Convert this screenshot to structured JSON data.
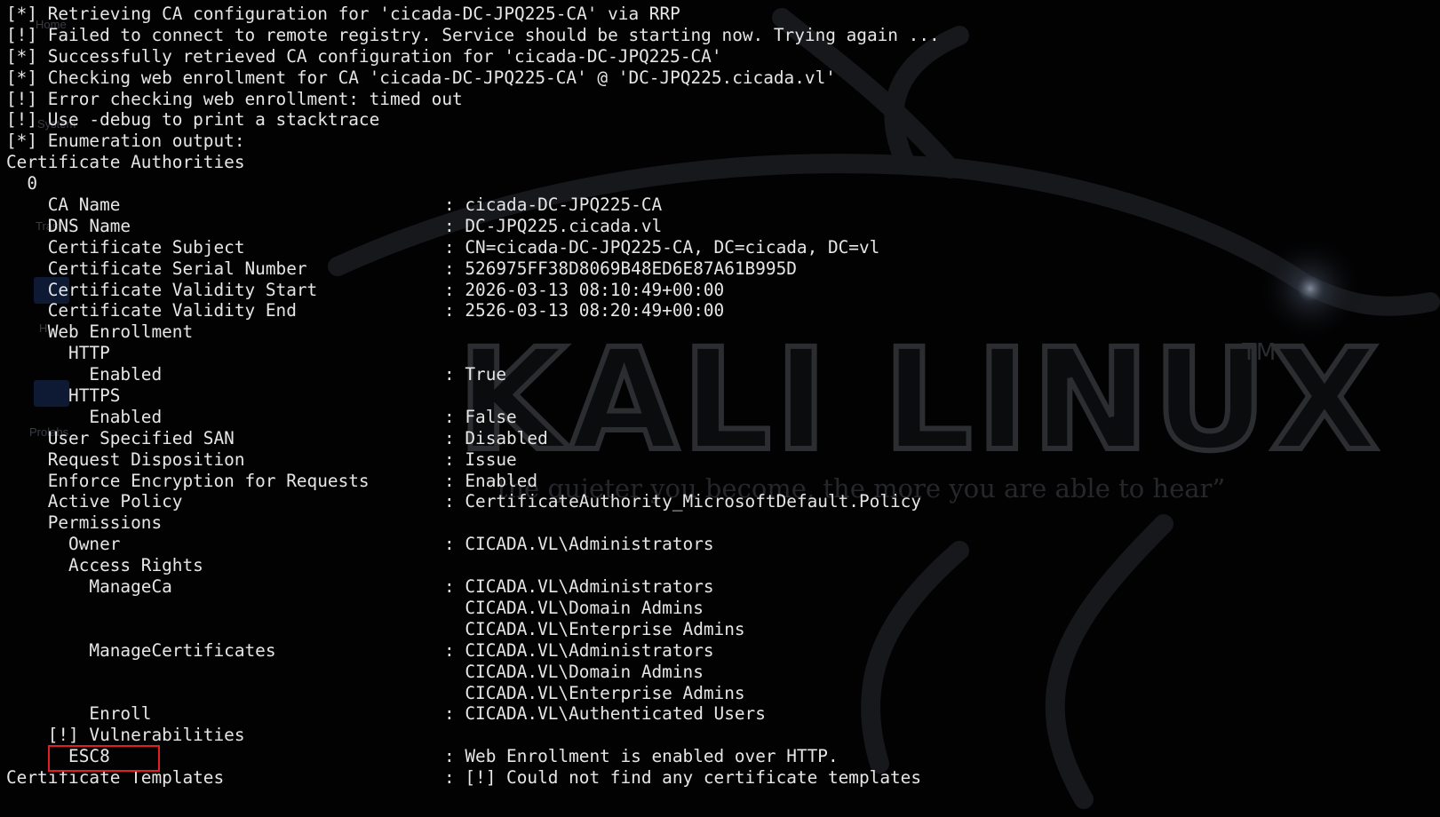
{
  "wallpaper": {
    "brand": "KALI LINUX",
    "trademark": "TM",
    "tagline": "“the quieter you become, the more you are able to hear”"
  },
  "desktop": {
    "icons": [
      {
        "label": "Home"
      },
      {
        "label": "System"
      },
      {
        "label": "Trash"
      },
      {
        "label": "H"
      },
      {
        "label": "Prolabs"
      }
    ]
  },
  "terminal": {
    "status_lines": [
      "[*] Retrieving CA configuration for 'cicada-DC-JPQ225-CA' via RRP",
      "[!] Failed to connect to remote registry. Service should be starting now. Trying again ...",
      "[*] Successfully retrieved CA configuration for 'cicada-DC-JPQ225-CA'",
      "[*] Checking web enrollment for CA 'cicada-DC-JPQ225-CA' @ 'DC-JPQ225.cicada.vl'",
      "[!] Error checking web enrollment: timed out",
      "[!] Use -debug to print a stacktrace",
      "[*] Enumeration output:"
    ],
    "section_ca": "Certificate Authorities",
    "ca_index": "  0",
    "rows": [
      {
        "key": "    CA Name",
        "val": "cicada-DC-JPQ225-CA"
      },
      {
        "key": "    DNS Name",
        "val": "DC-JPQ225.cicada.vl"
      },
      {
        "key": "    Certificate Subject",
        "val": "CN=cicada-DC-JPQ225-CA, DC=cicada, DC=vl"
      },
      {
        "key": "    Certificate Serial Number",
        "val": "526975FF38D8069B48ED6E87A61B995D"
      },
      {
        "key": "    Certificate Validity Start",
        "val": "2026-03-13 08:10:49+00:00"
      },
      {
        "key": "    Certificate Validity End",
        "val": "2526-03-13 08:20:49+00:00"
      },
      {
        "key": "    Web Enrollment",
        "val": null
      },
      {
        "key": "      HTTP",
        "val": null
      },
      {
        "key": "        Enabled",
        "val": "True"
      },
      {
        "key": "      HTTPS",
        "val": null
      },
      {
        "key": "        Enabled",
        "val": "False"
      },
      {
        "key": "    User Specified SAN",
        "val": "Disabled"
      },
      {
        "key": "    Request Disposition",
        "val": "Issue"
      },
      {
        "key": "    Enforce Encryption for Requests",
        "val": "Enabled"
      },
      {
        "key": "    Active Policy",
        "val": "CertificateAuthority_MicrosoftDefault.Policy"
      },
      {
        "key": "    Permissions",
        "val": null
      },
      {
        "key": "      Owner",
        "val": "CICADA.VL\\Administrators"
      },
      {
        "key": "      Access Rights",
        "val": null
      },
      {
        "key": "        ManageCa",
        "val": "CICADA.VL\\Administrators"
      },
      {
        "key": "",
        "val": "CICADA.VL\\Domain Admins",
        "cont": true
      },
      {
        "key": "",
        "val": "CICADA.VL\\Enterprise Admins",
        "cont": true
      },
      {
        "key": "        ManageCertificates",
        "val": "CICADA.VL\\Administrators"
      },
      {
        "key": "",
        "val": "CICADA.VL\\Domain Admins",
        "cont": true
      },
      {
        "key": "",
        "val": "CICADA.VL\\Enterprise Admins",
        "cont": true
      },
      {
        "key": "        Enroll",
        "val": "CICADA.VL\\Authenticated Users"
      },
      {
        "key": "    [!] Vulnerabilities",
        "val": null
      },
      {
        "key": "      ESC8",
        "val": "Web Enrollment is enabled over HTTP.",
        "highlight": true
      },
      {
        "key": "Certificate Templates",
        "val": "[!] Could not find any certificate templates"
      }
    ]
  },
  "colors": {
    "background": "#020203",
    "text": "#e6e6e6",
    "highlight_box": "#e02020",
    "wallpaper_text": "#2c2d31"
  }
}
